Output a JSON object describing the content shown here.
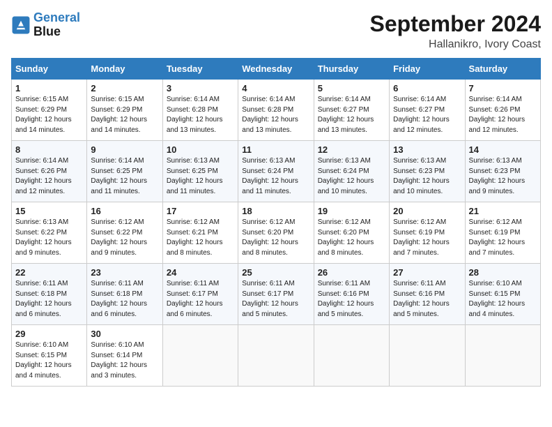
{
  "header": {
    "logo_line1": "General",
    "logo_line2": "Blue",
    "month": "September 2024",
    "location": "Hallanikro, Ivory Coast"
  },
  "weekdays": [
    "Sunday",
    "Monday",
    "Tuesday",
    "Wednesday",
    "Thursday",
    "Friday",
    "Saturday"
  ],
  "weeks": [
    [
      {
        "day": "1",
        "rise": "6:15 AM",
        "set": "6:29 PM",
        "daylight": "12 hours and 14 minutes."
      },
      {
        "day": "2",
        "rise": "6:15 AM",
        "set": "6:29 PM",
        "daylight": "12 hours and 14 minutes."
      },
      {
        "day": "3",
        "rise": "6:14 AM",
        "set": "6:28 PM",
        "daylight": "12 hours and 13 minutes."
      },
      {
        "day": "4",
        "rise": "6:14 AM",
        "set": "6:28 PM",
        "daylight": "12 hours and 13 minutes."
      },
      {
        "day": "5",
        "rise": "6:14 AM",
        "set": "6:27 PM",
        "daylight": "12 hours and 13 minutes."
      },
      {
        "day": "6",
        "rise": "6:14 AM",
        "set": "6:27 PM",
        "daylight": "12 hours and 12 minutes."
      },
      {
        "day": "7",
        "rise": "6:14 AM",
        "set": "6:26 PM",
        "daylight": "12 hours and 12 minutes."
      }
    ],
    [
      {
        "day": "8",
        "rise": "6:14 AM",
        "set": "6:26 PM",
        "daylight": "12 hours and 12 minutes."
      },
      {
        "day": "9",
        "rise": "6:14 AM",
        "set": "6:25 PM",
        "daylight": "12 hours and 11 minutes."
      },
      {
        "day": "10",
        "rise": "6:13 AM",
        "set": "6:25 PM",
        "daylight": "12 hours and 11 minutes."
      },
      {
        "day": "11",
        "rise": "6:13 AM",
        "set": "6:24 PM",
        "daylight": "12 hours and 11 minutes."
      },
      {
        "day": "12",
        "rise": "6:13 AM",
        "set": "6:24 PM",
        "daylight": "12 hours and 10 minutes."
      },
      {
        "day": "13",
        "rise": "6:13 AM",
        "set": "6:23 PM",
        "daylight": "12 hours and 10 minutes."
      },
      {
        "day": "14",
        "rise": "6:13 AM",
        "set": "6:23 PM",
        "daylight": "12 hours and 9 minutes."
      }
    ],
    [
      {
        "day": "15",
        "rise": "6:13 AM",
        "set": "6:22 PM",
        "daylight": "12 hours and 9 minutes."
      },
      {
        "day": "16",
        "rise": "6:12 AM",
        "set": "6:22 PM",
        "daylight": "12 hours and 9 minutes."
      },
      {
        "day": "17",
        "rise": "6:12 AM",
        "set": "6:21 PM",
        "daylight": "12 hours and 8 minutes."
      },
      {
        "day": "18",
        "rise": "6:12 AM",
        "set": "6:20 PM",
        "daylight": "12 hours and 8 minutes."
      },
      {
        "day": "19",
        "rise": "6:12 AM",
        "set": "6:20 PM",
        "daylight": "12 hours and 8 minutes."
      },
      {
        "day": "20",
        "rise": "6:12 AM",
        "set": "6:19 PM",
        "daylight": "12 hours and 7 minutes."
      },
      {
        "day": "21",
        "rise": "6:12 AM",
        "set": "6:19 PM",
        "daylight": "12 hours and 7 minutes."
      }
    ],
    [
      {
        "day": "22",
        "rise": "6:11 AM",
        "set": "6:18 PM",
        "daylight": "12 hours and 6 minutes."
      },
      {
        "day": "23",
        "rise": "6:11 AM",
        "set": "6:18 PM",
        "daylight": "12 hours and 6 minutes."
      },
      {
        "day": "24",
        "rise": "6:11 AM",
        "set": "6:17 PM",
        "daylight": "12 hours and 6 minutes."
      },
      {
        "day": "25",
        "rise": "6:11 AM",
        "set": "6:17 PM",
        "daylight": "12 hours and 5 minutes."
      },
      {
        "day": "26",
        "rise": "6:11 AM",
        "set": "6:16 PM",
        "daylight": "12 hours and 5 minutes."
      },
      {
        "day": "27",
        "rise": "6:11 AM",
        "set": "6:16 PM",
        "daylight": "12 hours and 5 minutes."
      },
      {
        "day": "28",
        "rise": "6:10 AM",
        "set": "6:15 PM",
        "daylight": "12 hours and 4 minutes."
      }
    ],
    [
      {
        "day": "29",
        "rise": "6:10 AM",
        "set": "6:15 PM",
        "daylight": "12 hours and 4 minutes."
      },
      {
        "day": "30",
        "rise": "6:10 AM",
        "set": "6:14 PM",
        "daylight": "12 hours and 3 minutes."
      },
      null,
      null,
      null,
      null,
      null
    ]
  ],
  "labels": {
    "sunrise": "Sunrise: ",
    "sunset": "Sunset: ",
    "daylight": "Daylight: "
  }
}
